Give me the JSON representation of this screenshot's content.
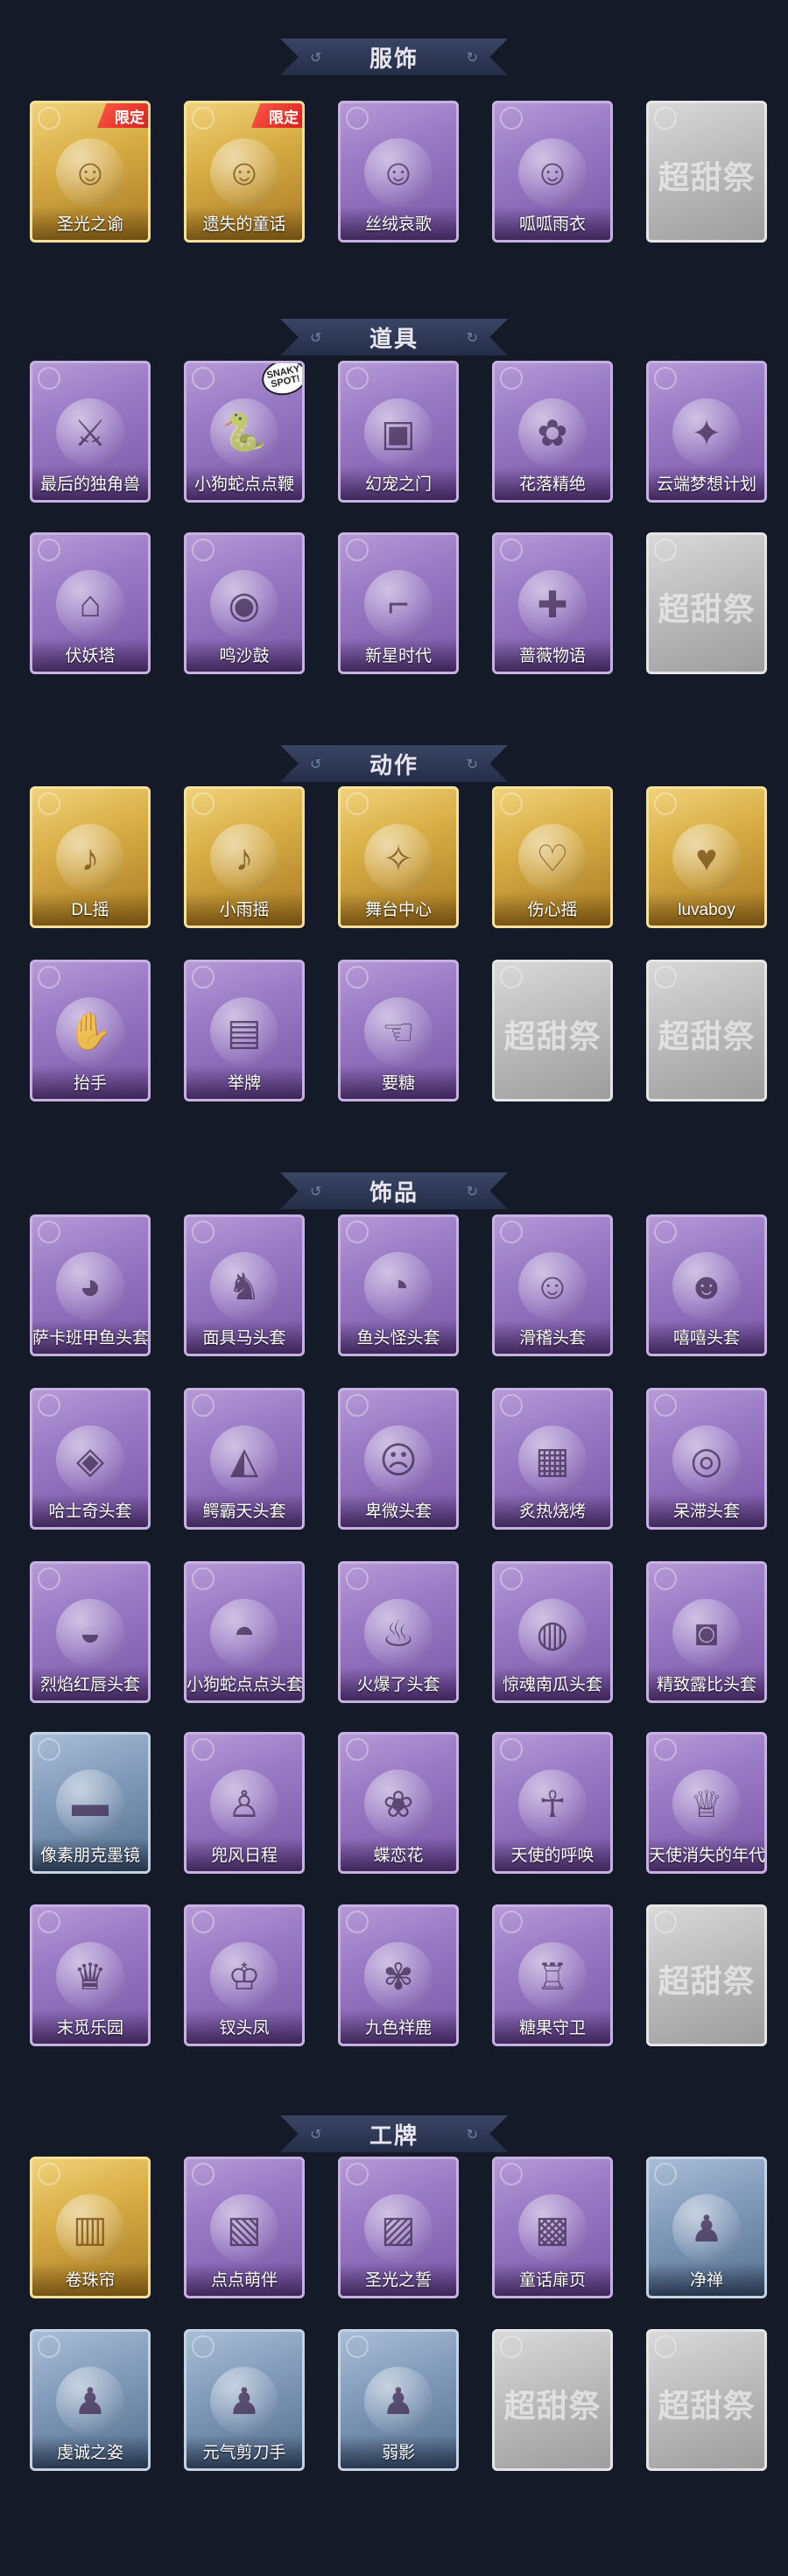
{
  "sections": [
    {
      "id": "clothing",
      "title": "服饰",
      "rows": [
        [
          {
            "label": "圣光之谕",
            "style": "gold",
            "icon": "portrait-icon",
            "glyph": "☺",
            "badge": "限定"
          },
          {
            "label": "遗失的童话",
            "style": "gold",
            "icon": "portrait-icon",
            "glyph": "☺",
            "badge": "限定"
          },
          {
            "label": "丝绒哀歌",
            "style": "purple",
            "icon": "portrait-icon",
            "glyph": "☺"
          },
          {
            "label": "呱呱雨衣",
            "style": "purple",
            "icon": "portrait-icon",
            "glyph": "☺"
          },
          {
            "label": "",
            "style": "gray",
            "icon": "placeholder-logo-icon",
            "logo": "超甜祭"
          }
        ]
      ]
    },
    {
      "id": "props",
      "title": "道具",
      "rows": [
        [
          {
            "label": "最后的独角兽",
            "style": "purple",
            "icon": "sword-icon",
            "glyph": "⚔"
          },
          {
            "label": "小狗蛇点点鞭",
            "style": "purple",
            "icon": "snake-icon",
            "glyph": "🐍",
            "sticker": "SNAKY SPOT!"
          },
          {
            "label": "幻宠之门",
            "style": "purple",
            "icon": "tablet-icon",
            "glyph": "▣"
          },
          {
            "label": "花落精绝",
            "style": "purple",
            "icon": "flower-icon",
            "glyph": "✿"
          },
          {
            "label": "云端梦想计划",
            "style": "purple",
            "icon": "scepter-icon",
            "glyph": "✦"
          }
        ],
        [
          {
            "label": "伏妖塔",
            "style": "purple",
            "icon": "pagoda-icon",
            "glyph": "⌂"
          },
          {
            "label": "鸣沙鼓",
            "style": "purple",
            "icon": "drum-icon",
            "glyph": "◉"
          },
          {
            "label": "新星时代",
            "style": "purple",
            "icon": "revolver-icon",
            "glyph": "⌐"
          },
          {
            "label": "蔷薇物语",
            "style": "purple",
            "icon": "medkit-icon",
            "glyph": "✚"
          },
          {
            "label": "",
            "style": "gray",
            "icon": "placeholder-logo-icon",
            "logo": "超甜祭"
          }
        ]
      ]
    },
    {
      "id": "actions",
      "title": "动作",
      "rows": [
        [
          {
            "label": "DL摇",
            "style": "gold",
            "icon": "pose-icon",
            "glyph": "♪"
          },
          {
            "label": "小雨摇",
            "style": "gold",
            "icon": "pose-icon",
            "glyph": "♪"
          },
          {
            "label": "舞台中心",
            "style": "gold",
            "icon": "pose-icon",
            "glyph": "✧"
          },
          {
            "label": "伤心摇",
            "style": "gold",
            "icon": "pose-icon",
            "glyph": "♡"
          },
          {
            "label": "luvaboy",
            "style": "gold",
            "icon": "pose-icon",
            "glyph": "♥"
          }
        ],
        [
          {
            "label": "抬手",
            "style": "purple",
            "icon": "pose-icon",
            "glyph": "✋"
          },
          {
            "label": "举牌",
            "style": "purple",
            "icon": "sign-icon",
            "glyph": "▤"
          },
          {
            "label": "要糖",
            "style": "purple",
            "icon": "pose-icon",
            "glyph": "☜"
          },
          {
            "label": "",
            "style": "gray",
            "icon": "placeholder-logo-icon",
            "logo": "超甜祭"
          },
          {
            "label": "",
            "style": "gray",
            "icon": "placeholder-logo-icon",
            "logo": "超甜祭"
          }
        ]
      ]
    },
    {
      "id": "accessories",
      "title": "饰品",
      "rows": [
        [
          {
            "label": "萨卡班甲鱼头套",
            "style": "purple",
            "icon": "fish-head-icon",
            "glyph": "◕"
          },
          {
            "label": "面具马头套",
            "style": "purple",
            "icon": "horse-head-icon",
            "glyph": "♞"
          },
          {
            "label": "鱼头怪头套",
            "style": "purple",
            "icon": "fish-monster-icon",
            "glyph": "◔"
          },
          {
            "label": "滑稽头套",
            "style": "purple",
            "icon": "smiley-icon",
            "glyph": "☺"
          },
          {
            "label": "嘻嘻头套",
            "style": "purple",
            "icon": "grin-icon",
            "glyph": "☻"
          }
        ],
        [
          {
            "label": "哈士奇头套",
            "style": "purple",
            "icon": "dog-head-icon",
            "glyph": "◈"
          },
          {
            "label": "鳄霸天头套",
            "style": "purple",
            "icon": "crocodile-icon",
            "glyph": "◭"
          },
          {
            "label": "卑微头套",
            "style": "purple",
            "icon": "sad-face-icon",
            "glyph": "☹"
          },
          {
            "label": "炙热烧烤",
            "style": "purple",
            "icon": "meat-icon",
            "glyph": "▦"
          },
          {
            "label": "呆滞头套",
            "style": "purple",
            "icon": "dazed-face-icon",
            "glyph": "◎"
          }
        ],
        [
          {
            "label": "烈焰红唇头套",
            "style": "purple",
            "icon": "pikachu-icon",
            "glyph": "◒"
          },
          {
            "label": "小狗蛇点点头套",
            "style": "purple",
            "icon": "snake-head-icon",
            "glyph": "◓"
          },
          {
            "label": "火爆了头套",
            "style": "purple",
            "icon": "flame-icon",
            "glyph": "♨"
          },
          {
            "label": "惊魂南瓜头套",
            "style": "purple",
            "icon": "pumpkin-icon",
            "glyph": "◍"
          },
          {
            "label": "精致露比头套",
            "style": "purple",
            "icon": "pig-head-icon",
            "glyph": "◙"
          }
        ],
        [
          {
            "label": "像素朋克墨镜",
            "style": "blue",
            "icon": "sunglasses-icon",
            "glyph": "▬"
          },
          {
            "label": "兜风日程",
            "style": "purple",
            "icon": "figure-icon",
            "glyph": "♙"
          },
          {
            "label": "蝶恋花",
            "style": "purple",
            "icon": "bell-icon",
            "glyph": "❀"
          },
          {
            "label": "天使的呼唤",
            "style": "purple",
            "icon": "angel-icon",
            "glyph": "☥"
          },
          {
            "label": "天使消失的年代",
            "style": "purple",
            "icon": "angel-icon",
            "glyph": "♕"
          }
        ],
        [
          {
            "label": "末觅乐园",
            "style": "purple",
            "icon": "doll-icon",
            "glyph": "♛"
          },
          {
            "label": "钗头凤",
            "style": "purple",
            "icon": "phoenix-crown-icon",
            "glyph": "♔"
          },
          {
            "label": "九色祥鹿",
            "style": "purple",
            "icon": "deer-icon",
            "glyph": "✾"
          },
          {
            "label": "糖果守卫",
            "style": "purple",
            "icon": "candy-guard-icon",
            "glyph": "♖"
          },
          {
            "label": "",
            "style": "gray",
            "icon": "placeholder-logo-icon",
            "logo": "超甜祭"
          }
        ]
      ]
    },
    {
      "id": "badges",
      "title": "工牌",
      "rows": [
        [
          {
            "label": "卷珠帘",
            "style": "gold",
            "icon": "badge-card-icon",
            "glyph": "▥"
          },
          {
            "label": "点点萌伴",
            "style": "purple",
            "icon": "badge-card-icon",
            "glyph": "▧"
          },
          {
            "label": "圣光之誓",
            "style": "purple",
            "icon": "badge-card-icon",
            "glyph": "▨"
          },
          {
            "label": "童话扉页",
            "style": "purple",
            "icon": "badge-card-icon",
            "glyph": "▩"
          },
          {
            "label": "净禅",
            "style": "blue",
            "icon": "silhouette-icon",
            "glyph": "♟"
          }
        ],
        [
          {
            "label": "虔诚之姿",
            "style": "blue",
            "icon": "silhouette-icon",
            "glyph": "♟"
          },
          {
            "label": "元气剪刀手",
            "style": "blue",
            "icon": "silhouette-icon",
            "glyph": "♟"
          },
          {
            "label": "弱影",
            "style": "blue",
            "icon": "silhouette-icon",
            "glyph": "♟"
          },
          {
            "label": "",
            "style": "gray",
            "icon": "placeholder-logo-icon",
            "logo": "超甜祭"
          },
          {
            "label": "",
            "style": "gray",
            "icon": "placeholder-logo-icon",
            "logo": "超甜祭"
          }
        ]
      ]
    }
  ]
}
